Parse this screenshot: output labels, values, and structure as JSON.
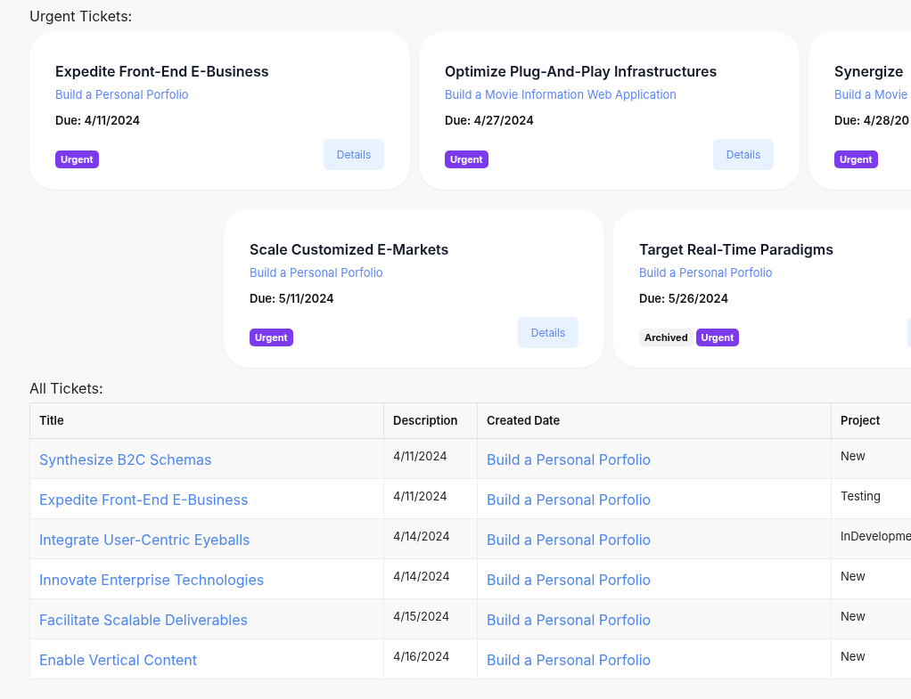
{
  "urgent_section": {
    "heading": "Urgent Tickets:",
    "card_rows": [
      [
        {
          "title": "Expedite Front-End E-Business",
          "project": "Build a Personal Porfolio",
          "due": "Due: 4/11/2024",
          "tags": [
            {
              "label": "Urgent",
              "kind": "urgent"
            }
          ],
          "button": "Details"
        },
        {
          "title": "Optimize Plug-And-Play Infrastructures",
          "project": "Build a Movie Information Web Application",
          "due": "Due: 4/27/2024",
          "tags": [
            {
              "label": "Urgent",
              "kind": "urgent"
            }
          ],
          "button": "Details"
        },
        {
          "title": "Synergize",
          "project": "Build a Movie",
          "due": "Due: 4/28/20",
          "tags": [
            {
              "label": "Urgent",
              "kind": "urgent"
            }
          ]
        }
      ],
      [
        {
          "title": "Scale Customized E-Markets",
          "project": "Build a Personal Porfolio",
          "due": "Due: 5/11/2024",
          "tags": [
            {
              "label": "Urgent",
              "kind": "urgent"
            }
          ],
          "button": "Details"
        },
        {
          "title": "Target Real-Time Paradigms",
          "project": "Build a Personal Porfolio",
          "due": "Due: 5/26/2024",
          "tags": [
            {
              "label": "Archived",
              "kind": "archived"
            },
            {
              "label": "Urgent",
              "kind": "urgent"
            }
          ],
          "button_visible": true
        }
      ]
    ]
  },
  "all_section": {
    "heading": "All Tickets:",
    "table": {
      "columns": [
        "Title",
        "Description",
        "Created Date",
        "Project"
      ],
      "rows": [
        [
          "Synthesize B2C Schemas",
          "4/11/2024",
          "Build a Personal Porfolio",
          "New"
        ],
        [
          "Expedite Front-End E-Business",
          "4/11/2024",
          "Build a Personal Porfolio",
          "Testing"
        ],
        [
          "Integrate User-Centric Eyeballs",
          "4/14/2024",
          "Build a Personal Porfolio",
          "InDevelopme"
        ],
        [
          "Innovate Enterprise Technologies",
          "4/14/2024",
          "Build a Personal Porfolio",
          "New"
        ],
        [
          "Facilitate Scalable Deliverables",
          "4/15/2024",
          "Build a Personal Porfolio",
          "New"
        ],
        [
          "Enable Vertical Content",
          "4/16/2024",
          "Build a Personal Porfolio",
          "New"
        ]
      ]
    }
  }
}
